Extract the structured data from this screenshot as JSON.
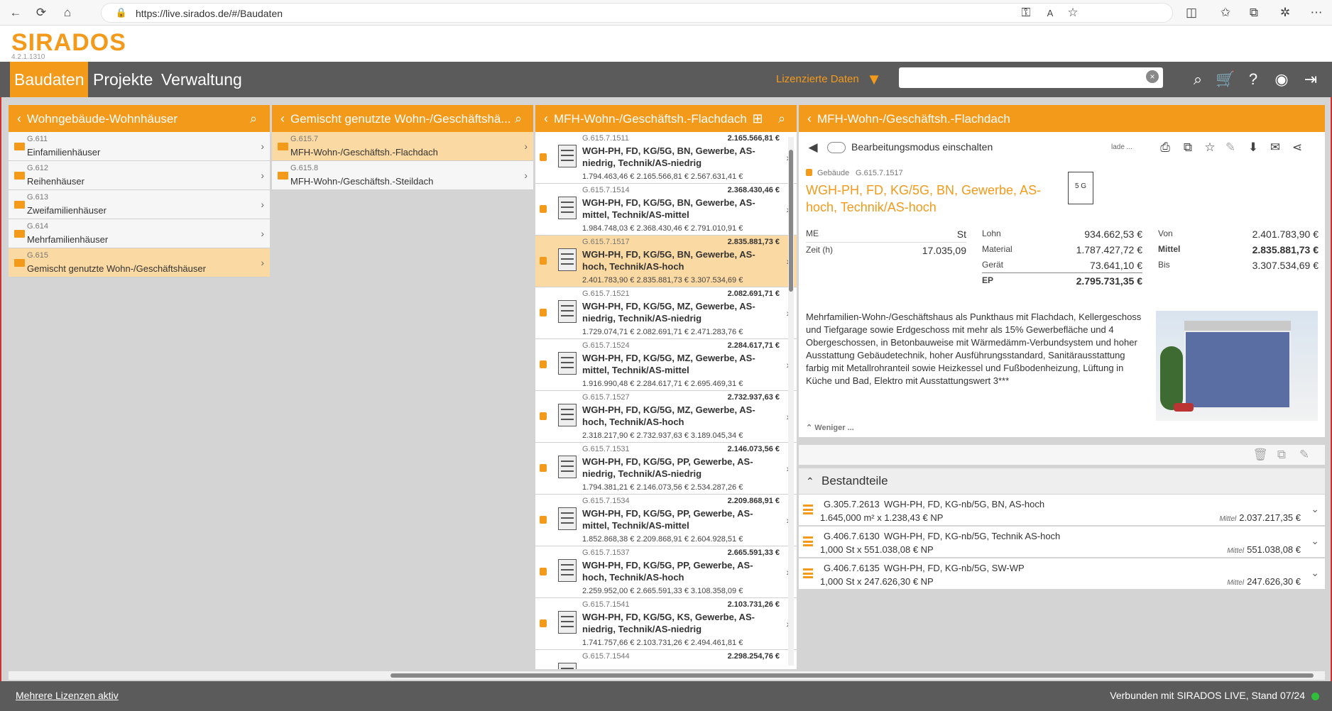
{
  "browser": {
    "url": "https://live.sirados.de/#/Baudaten"
  },
  "app": {
    "logo": "SIRADOS",
    "version": "4.2.1.1310"
  },
  "nav": {
    "items": [
      {
        "label": "Baudaten"
      },
      {
        "label": "Projekte"
      },
      {
        "label": "Verwaltung"
      }
    ],
    "licensed": "Lizenzierte Daten",
    "search_placeholder": ""
  },
  "panel1": {
    "title": "Wohngebäude-Wohnhäuser",
    "rows": [
      {
        "code": "G.611",
        "name": "Einfamilienhäuser"
      },
      {
        "code": "G.612",
        "name": "Reihenhäuser"
      },
      {
        "code": "G.613",
        "name": "Zweifamilienhäuser"
      },
      {
        "code": "G.614",
        "name": "Mehrfamilienhäuser"
      },
      {
        "code": "G.615",
        "name": "Gemischt genutzte Wohn-/Geschäftshäuser"
      }
    ]
  },
  "panel2": {
    "title": "Gemischt genutzte Wohn-/Geschäftshä...",
    "rows": [
      {
        "code": "G.615.7",
        "name": "MFH-Wohn-/Geschäftsh.-Flachdach"
      },
      {
        "code": "G.615.8",
        "name": "MFH-Wohn-/Geschäftsh.-Steildach"
      }
    ]
  },
  "panel3": {
    "title": "MFH-Wohn-/Geschäftsh.-Flachdach",
    "items": [
      {
        "code": "G.615.7.1511",
        "price": "2.165.566,81 €",
        "title": "WGH-PH, FD, KG/5G, BN, Gewerbe, AS-niedrig, Technik/AS-niedrig",
        "range": "1.794.463,46 € 2.165.566,81 € 2.567.631,41 €"
      },
      {
        "code": "G.615.7.1514",
        "price": "2.368.430,46 €",
        "title": "WGH-PH, FD, KG/5G, BN, Gewerbe, AS-mittel, Technik/AS-mittel",
        "range": "1.984.748,03 € 2.368.430,46 € 2.791.010,91 €"
      },
      {
        "code": "G.615.7.1517",
        "price": "2.835.881,73 €",
        "title": "WGH-PH, FD, KG/5G, BN, Gewerbe, AS-hoch, Technik/AS-hoch",
        "range": "2.401.783,90 € 2.835.881,73 € 3.307.534,69 €"
      },
      {
        "code": "G.615.7.1521",
        "price": "2.082.691,71 €",
        "title": "WGH-PH, FD, KG/5G, MZ, Gewerbe, AS-niedrig, Technik/AS-niedrig",
        "range": "1.729.074,71 € 2.082.691,71 € 2.471.283,76 €"
      },
      {
        "code": "G.615.7.1524",
        "price": "2.284.617,71 €",
        "title": "WGH-PH, FD, KG/5G, MZ, Gewerbe, AS-mittel, Technik/AS-mittel",
        "range": "1.916.990,48 € 2.284.617,71 € 2.695.469,31 €"
      },
      {
        "code": "G.615.7.1527",
        "price": "2.732.937,63 €",
        "title": "WGH-PH, FD, KG/5G, MZ, Gewerbe, AS-hoch, Technik/AS-hoch",
        "range": "2.318.217,90 € 2.732.937,63 € 3.189.045,34 €"
      },
      {
        "code": "G.615.7.1531",
        "price": "2.146.073,56 €",
        "title": "WGH-PH, FD, KG/5G, PP, Gewerbe, AS-niedrig, Technik/AS-niedrig",
        "range": "1.794.381,21 € 2.146.073,56 € 2.534.287,26 €"
      },
      {
        "code": "G.615.7.1534",
        "price": "2.209.868,91 €",
        "title": "WGH-PH, FD, KG/5G, PP, Gewerbe, AS-mittel, Technik/AS-mittel",
        "range": "1.852.868,38 € 2.209.868,91 € 2.604.928,51 €"
      },
      {
        "code": "G.615.7.1537",
        "price": "2.665.591,33 €",
        "title": "WGH-PH, FD, KG/5G, PP, Gewerbe, AS-hoch, Technik/AS-hoch",
        "range": "2.259.952,00 € 2.665.591,33 € 3.108.358,09 €"
      },
      {
        "code": "G.615.7.1541",
        "price": "2.103.731,26 €",
        "title": "WGH-PH, FD, KG/5G, KS, Gewerbe, AS-niedrig, Technik/AS-niedrig",
        "range": "1.741.757,66 € 2.103.731,26 € 2.494.461,81 €"
      },
      {
        "code": "G.615.7.1544",
        "price": "2.298.254,76 €",
        "title": "",
        "range": ""
      }
    ]
  },
  "detail": {
    "header": "MFH-Wohn-/Geschäftsh.-Flachdach",
    "edit_mode": "Bearbeitungsmodus einschalten",
    "loading": "lade ...",
    "type_label": "Gebäude",
    "code": "G.615.7.1517",
    "title": "WGH-PH, FD, KG/5G, BN, Gewerbe, AS-hoch, Technik/AS-hoch",
    "thumb_label": "5 G",
    "me_label": "ME",
    "me_value": "St",
    "zeit_label": "Zeit (h)",
    "zeit_value": "17.035,09",
    "lohn_label": "Lohn",
    "lohn_value": "934.662,53 €",
    "material_label": "Material",
    "material_value": "1.787.427,72 €",
    "geraet_label": "Gerät",
    "geraet_value": "73.641,10 €",
    "ep_label": "EP",
    "ep_value": "2.795.731,35 €",
    "von_label": "Von",
    "von_value": "2.401.783,90 €",
    "mittel_label": "Mittel",
    "mittel_value": "2.835.881,73 €",
    "bis_label": "Bis",
    "bis_value": "3.307.534,69 €",
    "description": "Mehrfamilien-Wohn-/Geschäftshaus als Punkthaus mit Flachdach, Kellergeschoss und Tiefgarage sowie Erdgeschoss mit mehr als 15% Gewerbefläche und 4 Obergeschossen, in Betonbauweise mit Wärmedämm-Verbundsystem und hoher Ausstattung Gebäudetechnik, hoher Ausführungsstandard, Sanitärausstattung farbig mit Metallrohranteil sowie Heizkessel und Fußbodenheizung, Lüftung in Küche und Bad, Elektro mit Ausstattungswert 3***",
    "less": "Weniger ..."
  },
  "bestandteile": {
    "title": "Bestandteile",
    "rows": [
      {
        "code": "G.305.7.2613",
        "title": "WGH-PH, FD, KG-nb/5G, BN, AS-hoch",
        "qty": "1.645,000 m² x 1.238,43 € NP",
        "mittel_label": "Mittel",
        "mittel": "2.037.217,35 €"
      },
      {
        "code": "G.406.7.6130",
        "title": "WGH-PH, FD, KG-nb/5G, Technik AS-hoch",
        "qty": "1,000 St x 551.038,08 € NP",
        "mittel_label": "Mittel",
        "mittel": "551.038,08 €"
      },
      {
        "code": "G.406.7.6135",
        "title": "WGH-PH, FD, KG-nb/5G, SW-WP",
        "qty": "1,000 St x 247.626,30 € NP",
        "mittel_label": "Mittel",
        "mittel": "247.626,30 €"
      }
    ]
  },
  "footer": {
    "left": "Mehrere Lizenzen aktiv",
    "right": "Verbunden mit SIRADOS LIVE, Stand 07/24"
  },
  "colors": {
    "accent": "#f39a1b",
    "nav": "#5b5b5b",
    "selected": "#fbd9a2",
    "online": "#2fbf3a"
  }
}
